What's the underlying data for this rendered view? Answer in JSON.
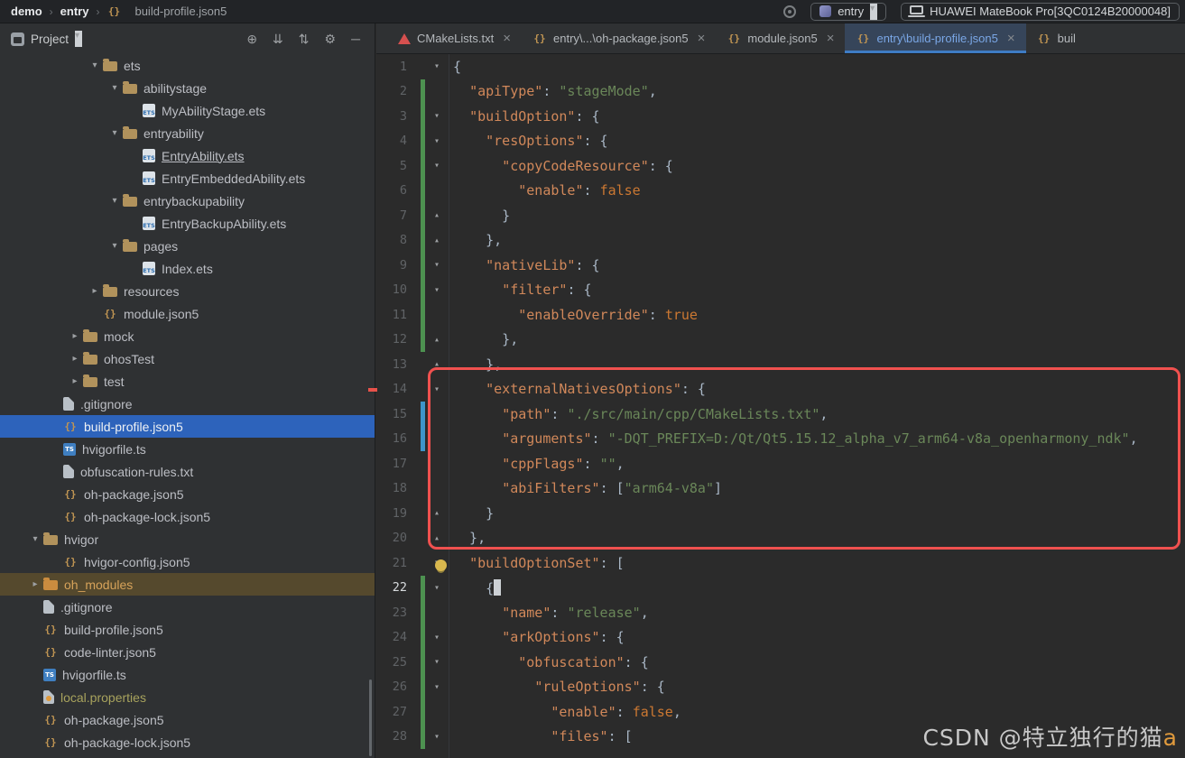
{
  "title_bar": {
    "breadcrumbs": [
      {
        "label": "demo",
        "bold": true
      },
      {
        "label": "entry",
        "bold": true
      },
      {
        "label": "build-profile.json5",
        "icon": "json5"
      }
    ],
    "run_config": {
      "label": "entry"
    },
    "device": {
      "label": "HUAWEI MateBook Pro[3QC0124B20000048]"
    }
  },
  "project_panel": {
    "header": {
      "title": "Project",
      "icons": [
        {
          "name": "locate",
          "glyph": "⊕"
        },
        {
          "name": "expand-all",
          "glyph": "⇊"
        },
        {
          "name": "collapse-all",
          "glyph": "⇅"
        },
        {
          "name": "settings",
          "glyph": "⚙"
        },
        {
          "name": "hide-panel",
          "glyph": "─"
        }
      ]
    },
    "tree": [
      {
        "label": "ets",
        "level": 4,
        "type": "folder",
        "expanded": true
      },
      {
        "label": "abilitystage",
        "level": 5,
        "type": "folder",
        "expanded": true
      },
      {
        "label": "MyAbilityStage.ets",
        "level": 6,
        "type": "file",
        "icon": "ets"
      },
      {
        "label": "entryability",
        "level": 5,
        "type": "folder",
        "expanded": true
      },
      {
        "label": "EntryAbility.ets",
        "level": 6,
        "type": "file",
        "icon": "ets",
        "underline": true
      },
      {
        "label": "EntryEmbeddedAbility.ets",
        "level": 6,
        "type": "file",
        "icon": "ets"
      },
      {
        "label": "entrybackupability",
        "level": 5,
        "type": "folder",
        "expanded": true
      },
      {
        "label": "EntryBackupAbility.ets",
        "level": 6,
        "type": "file",
        "icon": "ets"
      },
      {
        "label": "pages",
        "level": 5,
        "type": "folder",
        "expanded": true
      },
      {
        "label": "Index.ets",
        "level": 6,
        "type": "file",
        "icon": "ets"
      },
      {
        "label": "resources",
        "level": 4,
        "type": "folder",
        "expanded": false
      },
      {
        "label": "module.json5",
        "level": 4,
        "type": "file",
        "icon": "json5"
      },
      {
        "label": "mock",
        "level": 3,
        "type": "folder",
        "expanded": false
      },
      {
        "label": "ohosTest",
        "level": 3,
        "type": "folder",
        "expanded": false
      },
      {
        "label": "test",
        "level": 3,
        "type": "folder",
        "expanded": false
      },
      {
        "label": ".gitignore",
        "level": 2,
        "type": "file",
        "icon": "file"
      },
      {
        "label": "build-profile.json5",
        "level": 2,
        "type": "file",
        "icon": "json5",
        "selected": true
      },
      {
        "label": "hvigorfile.ts",
        "level": 2,
        "type": "file",
        "icon": "ts"
      },
      {
        "label": "obfuscation-rules.txt",
        "level": 2,
        "type": "file",
        "icon": "txt"
      },
      {
        "label": "oh-package.json5",
        "level": 2,
        "type": "file",
        "icon": "json5"
      },
      {
        "label": "oh-package-lock.json5",
        "level": 2,
        "type": "file",
        "icon": "json5"
      },
      {
        "label": "hvigor",
        "level": 1,
        "type": "folder",
        "expanded": true
      },
      {
        "label": "hvigor-config.json5",
        "level": 2,
        "type": "file",
        "icon": "json5"
      },
      {
        "label": "oh_modules",
        "level": 1,
        "type": "folder",
        "expanded": false,
        "highlight": "library"
      },
      {
        "label": ".gitignore",
        "level": 1,
        "type": "file",
        "icon": "file"
      },
      {
        "label": "build-profile.json5",
        "level": 1,
        "type": "file",
        "icon": "json5"
      },
      {
        "label": "code-linter.json5",
        "level": 1,
        "type": "file",
        "icon": "json5"
      },
      {
        "label": "hvigorfile.ts",
        "level": 1,
        "type": "file",
        "icon": "ts"
      },
      {
        "label": "local.properties",
        "level": 1,
        "type": "file",
        "icon": "props",
        "style": "ignored"
      },
      {
        "label": "oh-package.json5",
        "level": 1,
        "type": "file",
        "icon": "json5"
      },
      {
        "label": "oh-package-lock.json5",
        "level": 1,
        "type": "file",
        "icon": "json5"
      }
    ]
  },
  "editor": {
    "tabs": [
      {
        "label": "CMakeLists.txt",
        "icon": "cmake",
        "closable": true
      },
      {
        "label": "entry\\...\\oh-package.json5",
        "icon": "json5",
        "closable": true
      },
      {
        "label": "module.json5",
        "icon": "json5",
        "closable": true
      },
      {
        "label": "entry\\build-profile.json5",
        "icon": "json5",
        "closable": true,
        "active": true
      },
      {
        "label": "buil",
        "icon": "json5",
        "closable": false
      }
    ],
    "lines": [
      {
        "num": 1,
        "fold": "open",
        "tokens": [
          [
            "p",
            "{"
          ]
        ]
      },
      {
        "num": 2,
        "vcs": "g",
        "tokens": [
          [
            "p",
            "  "
          ],
          [
            "k",
            "\"apiType\""
          ],
          [
            "p",
            ": "
          ],
          [
            "s",
            "\"stageMode\""
          ],
          [
            "p",
            ","
          ]
        ]
      },
      {
        "num": 3,
        "fold": "open",
        "vcs": "g",
        "tokens": [
          [
            "p",
            "  "
          ],
          [
            "k",
            "\"buildOption\""
          ],
          [
            "p",
            ": {"
          ]
        ]
      },
      {
        "num": 4,
        "fold": "open",
        "vcs": "g",
        "tokens": [
          [
            "p",
            "    "
          ],
          [
            "k",
            "\"resOptions\""
          ],
          [
            "p",
            ": {"
          ]
        ]
      },
      {
        "num": 5,
        "fold": "open",
        "vcs": "g",
        "tokens": [
          [
            "p",
            "      "
          ],
          [
            "k",
            "\"copyCodeResource\""
          ],
          [
            "p",
            ": {"
          ]
        ]
      },
      {
        "num": 6,
        "vcs": "g",
        "tokens": [
          [
            "p",
            "        "
          ],
          [
            "k",
            "\"enable\""
          ],
          [
            "p",
            ": "
          ],
          [
            "b",
            "false"
          ]
        ]
      },
      {
        "num": 7,
        "fold": "end",
        "vcs": "g",
        "tokens": [
          [
            "p",
            "      }"
          ]
        ]
      },
      {
        "num": 8,
        "fold": "end",
        "vcs": "g",
        "tokens": [
          [
            "p",
            "    },"
          ]
        ]
      },
      {
        "num": 9,
        "fold": "open",
        "vcs": "g",
        "tokens": [
          [
            "p",
            "    "
          ],
          [
            "k",
            "\"nativeLib\""
          ],
          [
            "p",
            ": {"
          ]
        ]
      },
      {
        "num": 10,
        "fold": "open",
        "vcs": "g",
        "tokens": [
          [
            "p",
            "      "
          ],
          [
            "k",
            "\"filter\""
          ],
          [
            "p",
            ": {"
          ]
        ]
      },
      {
        "num": 11,
        "vcs": "g",
        "tokens": [
          [
            "p",
            "        "
          ],
          [
            "k",
            "\"enableOverride\""
          ],
          [
            "p",
            ": "
          ],
          [
            "b",
            "true"
          ]
        ]
      },
      {
        "num": 12,
        "fold": "end",
        "vcs": "g",
        "tokens": [
          [
            "p",
            "      },"
          ]
        ]
      },
      {
        "num": 13,
        "fold": "end",
        "tokens": [
          [
            "p",
            "    },"
          ]
        ]
      },
      {
        "num": 14,
        "fold": "open",
        "tokens": [
          [
            "p",
            "    "
          ],
          [
            "k",
            "\"externalNativesOptions\""
          ],
          [
            "p",
            ": {"
          ]
        ]
      },
      {
        "num": 15,
        "vcs": "b",
        "tokens": [
          [
            "p",
            "      "
          ],
          [
            "k",
            "\"path\""
          ],
          [
            "p",
            ": "
          ],
          [
            "s",
            "\"./src/main/cpp/CMakeLists.txt\""
          ],
          [
            "p",
            ","
          ]
        ]
      },
      {
        "num": 16,
        "vcs": "b",
        "tokens": [
          [
            "p",
            "      "
          ],
          [
            "k",
            "\"arguments\""
          ],
          [
            "p",
            ": "
          ],
          [
            "s",
            "\"-DQT_PREFIX=D:/Qt/Qt5.15.12_alpha_v7_arm64-v8a_openharmony_ndk\""
          ],
          [
            "p",
            ","
          ]
        ]
      },
      {
        "num": 17,
        "tokens": [
          [
            "p",
            "      "
          ],
          [
            "k",
            "\"cppFlags\""
          ],
          [
            "p",
            ": "
          ],
          [
            "s",
            "\"\""
          ],
          [
            "p",
            ","
          ]
        ]
      },
      {
        "num": 18,
        "tokens": [
          [
            "p",
            "      "
          ],
          [
            "k",
            "\"abiFilters\""
          ],
          [
            "p",
            ": ["
          ],
          [
            "s",
            "\"arm64-v8a\""
          ],
          [
            "p",
            "]"
          ]
        ]
      },
      {
        "num": 19,
        "fold": "end",
        "tokens": [
          [
            "p",
            "    }"
          ]
        ]
      },
      {
        "num": 20,
        "fold": "end",
        "tokens": [
          [
            "p",
            "  },"
          ]
        ]
      },
      {
        "num": 21,
        "fold": "open",
        "bulb": true,
        "tokens": [
          [
            "p",
            "  "
          ],
          [
            "k",
            "\"buildOptionSet\""
          ],
          [
            "p",
            ": ["
          ]
        ]
      },
      {
        "num": 22,
        "fold": "open",
        "vcs": "g",
        "current": true,
        "caret": true,
        "tokens": [
          [
            "p",
            "    {"
          ]
        ]
      },
      {
        "num": 23,
        "vcs": "g",
        "tokens": [
          [
            "p",
            "      "
          ],
          [
            "k",
            "\"name\""
          ],
          [
            "p",
            ": "
          ],
          [
            "s",
            "\"release\""
          ],
          [
            "p",
            ","
          ]
        ]
      },
      {
        "num": 24,
        "fold": "open",
        "vcs": "g",
        "tokens": [
          [
            "p",
            "      "
          ],
          [
            "k",
            "\"arkOptions\""
          ],
          [
            "p",
            ": {"
          ]
        ]
      },
      {
        "num": 25,
        "fold": "open",
        "vcs": "g",
        "tokens": [
          [
            "p",
            "        "
          ],
          [
            "k",
            "\"obfuscation\""
          ],
          [
            "p",
            ": {"
          ]
        ]
      },
      {
        "num": 26,
        "fold": "open",
        "vcs": "g",
        "tokens": [
          [
            "p",
            "          "
          ],
          [
            "k",
            "\"ruleOptions\""
          ],
          [
            "p",
            ": {"
          ]
        ]
      },
      {
        "num": 27,
        "vcs": "g",
        "tokens": [
          [
            "p",
            "            "
          ],
          [
            "k",
            "\"enable\""
          ],
          [
            "p",
            ": "
          ],
          [
            "b",
            "false"
          ],
          [
            "p",
            ","
          ]
        ]
      },
      {
        "num": 28,
        "fold": "open",
        "vcs": "g",
        "tokens": [
          [
            "p",
            "            "
          ],
          [
            "k",
            "\"files\""
          ],
          [
            "p",
            ": ["
          ]
        ]
      }
    ]
  },
  "icons": {
    "folder": {},
    "ets": {
      "glyph": "ETS"
    },
    "ts": {
      "glyph": "TS"
    },
    "json5": {
      "glyph": "{}"
    },
    "txt": {},
    "file": {},
    "props": {},
    "cmake": {}
  },
  "annotation": {
    "type": "highlight-box",
    "color": "#f0514f",
    "covers_lines": "14-20"
  },
  "watermark": {
    "text": "CSDN @特立独行的猫",
    "suffix": "a"
  },
  "colors": {
    "selection_blue": "#2d63bb",
    "library_row_brown": "#55492d",
    "annotation_red": "#f0514f",
    "vcs_added_green": "#4d9150",
    "vcs_modified_blue": "#3e94c9",
    "active_tab_underline": "#3e7cc4",
    "json_key": "#d1885a",
    "json_string": "#6a8759",
    "json_keyword": "#cc7832"
  }
}
